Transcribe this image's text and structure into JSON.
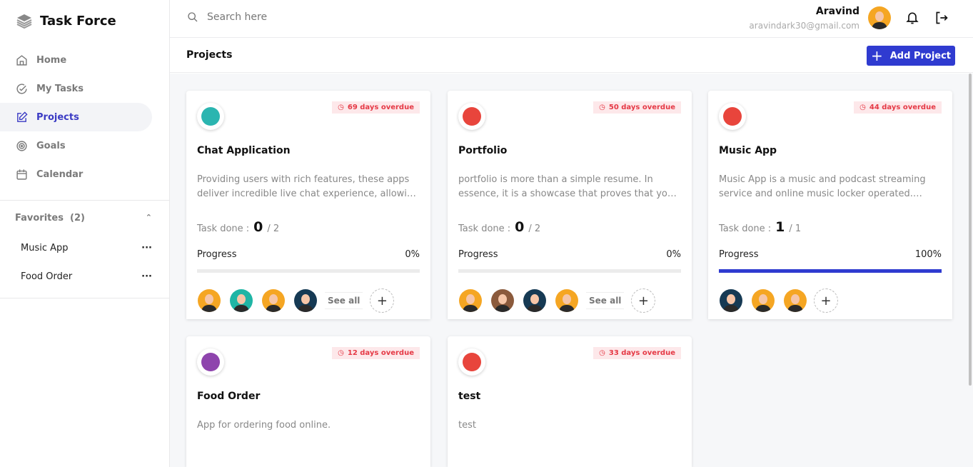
{
  "app": {
    "title": "Task Force"
  },
  "sidebar": {
    "items": [
      {
        "label": "Home",
        "icon": "home-icon"
      },
      {
        "label": "My Tasks",
        "icon": "check-circle-icon"
      },
      {
        "label": "Projects",
        "icon": "edit-icon",
        "active": true
      },
      {
        "label": "Goals",
        "icon": "target-icon"
      },
      {
        "label": "Calendar",
        "icon": "calendar-icon"
      }
    ],
    "favorites_label": "Favorites",
    "favorites_count": "(2)",
    "favorites": [
      {
        "label": "Music App"
      },
      {
        "label": "Food Order"
      }
    ]
  },
  "header": {
    "search_placeholder": "Search here",
    "user_name": "Aravind",
    "user_email": "aravindark30@gmail.com"
  },
  "page": {
    "title": "Projects",
    "add_label": "Add Project"
  },
  "colors": {
    "accent": "#2f3bd0",
    "overdue": "#e53945"
  },
  "labels": {
    "task_done": "Task done :",
    "progress": "Progress",
    "see_all": "See all"
  },
  "projects": [
    {
      "title": "Chat Application",
      "overdue": "69 days overdue",
      "description": "Providing users with rich features, these apps deliver incredible live chat experience, allowing users to communicate in real time.",
      "done": "0",
      "total": "/ 2",
      "progress": "0%",
      "progress_value": 0,
      "icon_color": "#2bb5b0",
      "members": [
        "#f5a623",
        "#1fb5a5",
        "#f5a623",
        "#163a54"
      ],
      "see_all": true
    },
    {
      "title": "Portfolio",
      "overdue": "50 days overdue",
      "description": "portfolio is more than a simple resume. In essence, it is a showcase that proves that you have the skills.",
      "done": "0",
      "total": "/ 2",
      "progress": "0%",
      "progress_value": 0,
      "icon_color": "#e8453c",
      "members": [
        "#f5a623",
        "#8b5a3c",
        "#163a54",
        "#f5a623"
      ],
      "see_all": true
    },
    {
      "title": "Music App",
      "overdue": "44 days overdue",
      "description": "Music App is a music and podcast streaming service and online music locker operated. Music everywhere.",
      "done": "1",
      "total": "/ 1",
      "progress": "100%",
      "progress_value": 100,
      "icon_color": "#e8453c",
      "members": [
        "#163a54",
        "#f5a623",
        "#f5a623"
      ],
      "see_all": false
    },
    {
      "title": "Food Order",
      "overdue": "12 days overdue",
      "description": "App for ordering food online.",
      "icon_color": "#8e44ad"
    },
    {
      "title": "test",
      "overdue": "33 days overdue",
      "description": "test",
      "icon_color": "#e8453c"
    }
  ]
}
